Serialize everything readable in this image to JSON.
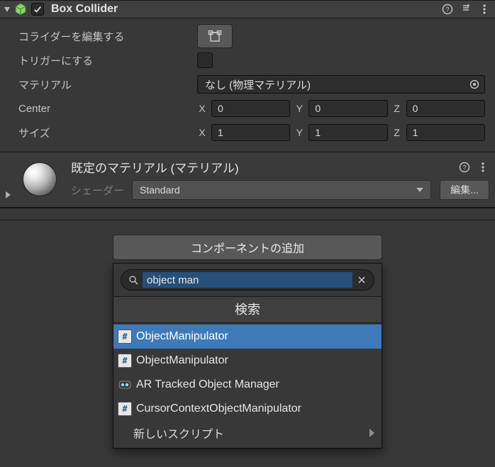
{
  "boxCollider": {
    "title": "Box Collider",
    "enabled": true,
    "editLabel": "コライダーを編集する",
    "triggerLabel": "トリガーにする",
    "materialLabel": "マテリアル",
    "materialValue": "なし (物理マテリアル)",
    "centerLabel": "Center",
    "sizeLabel": "サイズ",
    "center": {
      "x": "0",
      "y": "0",
      "z": "0"
    },
    "size": {
      "x": "1",
      "y": "1",
      "z": "1"
    },
    "axes": {
      "x": "X",
      "y": "Y",
      "z": "Z"
    }
  },
  "material": {
    "title": "既定のマテリアル (マテリアル)",
    "shaderLabel": "シェーダー",
    "shaderValue": "Standard",
    "editLabel": "編集..."
  },
  "addComponent": {
    "button": "コンポーネントの追加",
    "searchValue": "object man",
    "searchHeader": "検索",
    "results": [
      {
        "label": "ObjectManipulator",
        "icon": "script",
        "selected": true
      },
      {
        "label": "ObjectManipulator",
        "icon": "script",
        "selected": false
      },
      {
        "label": "AR Tracked Object Manager",
        "icon": "ar",
        "selected": false
      },
      {
        "label": "CursorContextObjectManipulator",
        "icon": "script",
        "selected": false
      }
    ],
    "newScript": "新しいスクリプト"
  }
}
